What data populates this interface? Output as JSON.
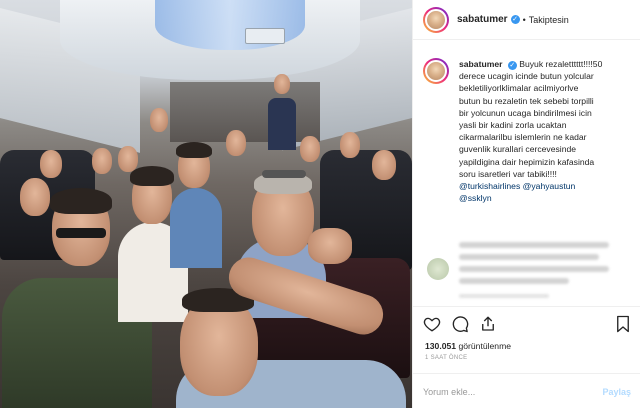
{
  "post": {
    "username": "sabatumer",
    "follow_label": "Takiptesin",
    "dot": "•",
    "caption_lines": [
      "Buyuk rezaletttttt!!!!50",
      "derece ucagin icinde butun yolcular",
      "bekletiliyorlklimalar acilmiyorlve",
      "butun bu rezaletin tek sebebi torpilli",
      "bir yolcunun ucaga bindirilmesi icin",
      "yasli bir kadini zorla ucaktan",
      "cikarmalarilbu islemlerin ne kadar",
      "guvenlik kurallari cercevesinde",
      "yapildigina dair hepimizin kafasinda",
      "soru isaretleri var tabiki!!!!"
    ],
    "mentions_line": "@turkishairlines @yahyaustun",
    "mentions_line2": "@ssklyn",
    "views_count": "130.051",
    "views_label": "görüntülenme",
    "time_label": "1 SAAT ÖNCE",
    "comment_placeholder": "Yorum ekle...",
    "post_button": "Paylaş"
  },
  "icons": {
    "heart": "heart-icon",
    "comment": "comment-icon",
    "share": "share-icon",
    "save": "bookmark-icon",
    "verified": "verified-badge-icon"
  },
  "colors": {
    "verified": "#3897f0",
    "mention": "#003569",
    "post_button": "#b3dbff"
  }
}
